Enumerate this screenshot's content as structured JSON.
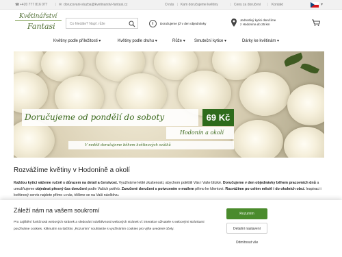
{
  "topbar": {
    "phone": "+420 777 816 077",
    "email": "dorucovani-sluzba@kvetinarstvi-fantasi.cz",
    "links": [
      "O nás",
      "Kam doručujeme květiny",
      "Ceny za doručení",
      "Kontakt"
    ]
  },
  "logo": {
    "line1": "Květinářství",
    "line2": "Fantasi"
  },
  "search": {
    "placeholder": "Co hledáte? Např. růže"
  },
  "info_order": "Doručujeme již v den objednávky",
  "info_delivery": {
    "line1": "Jednotlivý kytici doručíme",
    "line2": "z Hodonína do 25 km"
  },
  "nav": {
    "items": [
      "Květiny podle příležitosti",
      "Květiny podle druhu",
      "Růže",
      "Smuteční kytice",
      "Dárky ke květinám"
    ],
    "chevron": "▾"
  },
  "hero": {
    "headline": "Doručujeme od pondělí do soboty",
    "price": "69 Kč",
    "sub": "Hodonín a okolí",
    "note": "V neděli doručujeme během květinových svátků"
  },
  "content": {
    "heading": "Rozvážíme květiny v Hodoníně a okolí",
    "p1_b1": "Každou kytici vážeme ručně s důrazem na detail a čerstvost.",
    "p1_t1": " Využíváme letité zkušenosti, abychom potěšili Vás i Vaše blízké. ",
    "p1_b2": "Doručujeme v den objednávky během pracovních dnů",
    "p1_t2": " a umožňujeme ",
    "p1_b3": "objednat přesný čas doručení",
    "p1_t3": " podle Vašich potřeb. ",
    "p1_b4": "Zaručené doručení s potvrzením e-mailem",
    "p1_t4": " přímo ke klientovi. ",
    "p1_b5": "Rozvážíme po celém městě i do okolních obcí.",
    "p1_t5": " Inspiraci i květinový servis najdete přímo u nás, těšíme se na Vaši návštěvu."
  },
  "cookie": {
    "title": "Záleží nám na vašem soukromí",
    "text": "Pro zajištění funkčnosti webových stránek a sledování návštěvnosti webových stránek ví: interakce uživatele s webovými stránkami používáme cookies. Kliknutím na tlačítko „Rozumím“ souhlasíte s využíváním cookies pro výše uvedené účely.",
    "accept": "Rozumím",
    "settings": "Detailní nastavení",
    "reject": "Odmítnout vše"
  },
  "colors": {
    "brand_green": "#2e6b1c",
    "accept_green": "#4a8b2c",
    "hero_text_green": "#3c6a1e"
  },
  "icons": [
    "phone-icon",
    "email-icon",
    "search-icon",
    "clock-icon",
    "location-pin-icon",
    "cart-icon",
    "flag-cz-icon"
  ]
}
